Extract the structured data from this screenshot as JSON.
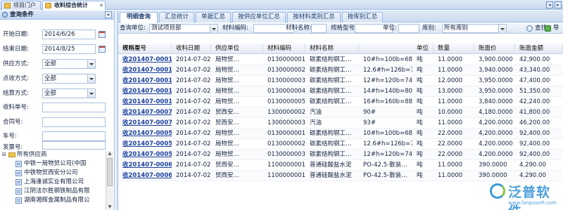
{
  "tabs": [
    {
      "label": "项目门户"
    },
    {
      "label": "收料综合统计"
    }
  ],
  "left_panel": {
    "title": "查询条件",
    "fields": [
      {
        "label": "开始日期:",
        "value": "2014/6/26"
      },
      {
        "label": "结束日期:",
        "value": "2014/8/25"
      },
      {
        "label": "供应方式:",
        "value": "全部"
      },
      {
        "label": "点收方式:",
        "value": "全部"
      },
      {
        "label": "结算方式:",
        "value": "全部"
      },
      {
        "label": "收料单号:",
        "value": ""
      },
      {
        "label": "合同号:",
        "value": ""
      },
      {
        "label": "车号:",
        "value": ""
      },
      {
        "label": "发票号:",
        "value": ""
      }
    ],
    "tree": {
      "root": "所有供应商",
      "items": [
        "中铁一局物贸公司(中国",
        "中铁物贸西安分公司",
        "上海逢诚实业有限公司",
        "江阴法尔胜钢铁制品有限",
        "湖南湘辉金属制品有限公"
      ]
    }
  },
  "sub_tabs": [
    "明细查询",
    "汇总统计",
    "单据汇总",
    "按供应单位汇总",
    "按材料类别汇总",
    "按库别汇总"
  ],
  "toolbar": {
    "unit_label": "查询单位:",
    "unit_value": "测试项目部",
    "material_code_label": "材料编码:",
    "material_code_value": "",
    "material_name_label": "材料名称:",
    "material_name_value": "",
    "spec_label": "规格型号:",
    "spec_value": "",
    "unit2_label": "单位:",
    "unit2_value": "",
    "warehouse_label": "库别:",
    "warehouse_value": "所有库别",
    "search_label": "查找",
    "export_label": "导出"
  },
  "grid": {
    "headers": [
      "收料单号",
      "收料日期",
      "供应单位",
      "材料编码",
      "材料名称",
      "规格型号",
      "单位",
      "数量",
      "账面价",
      "账面金额"
    ],
    "rows": [
      [
        "收201407-0001",
        "2014-07-02",
        "局物贸…",
        "0130000001",
        "碳素结构钢工…",
        "10#h=100b=68d…",
        "吨",
        "11.0000",
        "3,900.0000",
        "42,900.00"
      ],
      [
        "收201407-0001",
        "2014-07-02",
        "局物贸…",
        "0130000002",
        "碳素结构钢工…",
        "12.6#h=126b=74…",
        "吨",
        "11.0000",
        "3,940.0000",
        "43,340.00"
      ],
      [
        "收201407-0001",
        "2014-07-02",
        "局物贸…",
        "0130000003",
        "碳素结构钢工…",
        "12#h=120b=74d…",
        "吨",
        "12.0000",
        "3,950.0000",
        "47,400.00"
      ],
      [
        "收201407-0001",
        "2014-07-02",
        "局物贸…",
        "0130000004",
        "碳素结构钢工…",
        "14#h=140b=80d…",
        "吨",
        "13.0000",
        "3,950.0000",
        "51,350.00"
      ],
      [
        "收201407-0001",
        "2014-07-02",
        "局物贸…",
        "0130000005",
        "碳素结构钢工…",
        "16#h=160b=88d…",
        "吨",
        "11.0000",
        "3,840.0000",
        "42,240.00"
      ],
      [
        "收201407-0007",
        "2014-07-02",
        "贸西安…",
        "1300000002",
        "汽油",
        "90#",
        "吨",
        "10.0000",
        "4,180.0000",
        "41,800.00"
      ],
      [
        "收201407-0007",
        "2014-07-02",
        "贸西安…",
        "1300000003",
        "汽油",
        "93#",
        "吨",
        "11.0000",
        "4,200.0000",
        "46,200.00"
      ],
      [
        "收201407-0005",
        "2014-07-02",
        "局物贸…",
        "0130000001",
        "碳素结构钢工…",
        "10#h=100b=68d…",
        "吨",
        "22.0000",
        "4,200.0000",
        "92,400.00"
      ],
      [
        "收201407-0005",
        "2014-07-02",
        "局物贸…",
        "0130000002",
        "碳素结构钢工…",
        "12.6#h=126b=74…",
        "吨",
        "22.0000",
        "4,200.0000",
        "92,400.00"
      ],
      [
        "收201407-0005",
        "2014-07-02",
        "局物贸…",
        "0130000003",
        "碳素结构钢工…",
        "12#h=120b=74d…",
        "吨",
        "22.0000",
        "4,200.0000",
        "92,400.00"
      ],
      [
        "收201407-0006",
        "2014-07-02",
        "贸西安…",
        "1100000001",
        "普通硅酸盐水泥",
        "PO-42.5-散装…",
        "吨",
        "11.0000",
        "390.0000",
        "4,290.00"
      ],
      [
        "收201407-0006",
        "2014-07-02",
        "贸西安…",
        "1100000001",
        "普通硅酸盐水泥",
        "PO-42.5-散装…",
        "吨",
        "11.0000",
        "390.0000",
        "4,290.00"
      ]
    ]
  },
  "watermark": {
    "main": "泛普软件",
    "sub": "www.fanpusoft.com"
  }
}
